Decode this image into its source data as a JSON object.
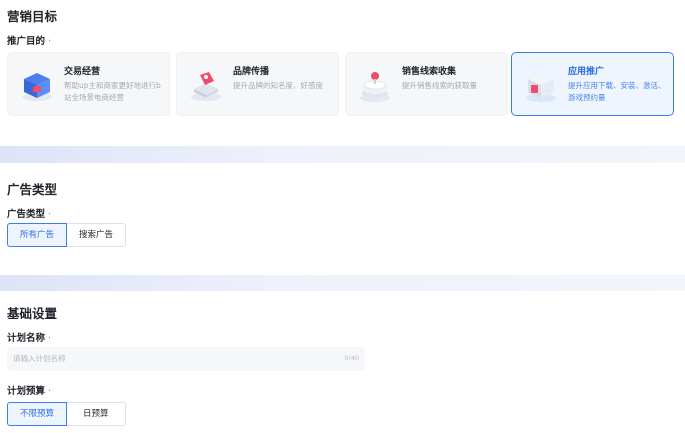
{
  "marketing": {
    "title": "营销目标",
    "purpose_label": "推广目的",
    "required_mark": "·",
    "cards": [
      {
        "title": "交易经营",
        "desc": "帮助up主和商家更好地进行b站全场景电商经营",
        "icon": "shopping-box-icon",
        "selected": false
      },
      {
        "title": "品牌传播",
        "desc": "提升品牌的知名度、好感度",
        "icon": "brand-tag-icon",
        "selected": false
      },
      {
        "title": "销售线索收集",
        "desc": "提升销售线索的获取量",
        "icon": "leads-stack-icon",
        "selected": false
      },
      {
        "title": "应用推广",
        "desc": "提升应用下载、安装、激活、游戏预约量",
        "icon": "app-package-icon",
        "selected": true
      }
    ]
  },
  "ad_type": {
    "title": "广告类型",
    "label": "广告类型",
    "required_mark": "·",
    "options": [
      "所有广告",
      "搜索广告"
    ],
    "selected": "所有广告"
  },
  "basic": {
    "title": "基础设置",
    "plan_name_label": "计划名称",
    "required_mark": "·",
    "plan_name_placeholder": "请输入计划名称",
    "plan_name_value": "",
    "plan_name_count": "0/40",
    "budget_label": "计划预算",
    "budget_options": [
      "不限预算",
      "日预算"
    ],
    "budget_selected": "不限预算"
  },
  "colors": {
    "accent": "#3b7ef0",
    "selected_bg": "#eef5ff",
    "card_bg": "#f6f7f9",
    "band": "#e4e9f8"
  }
}
